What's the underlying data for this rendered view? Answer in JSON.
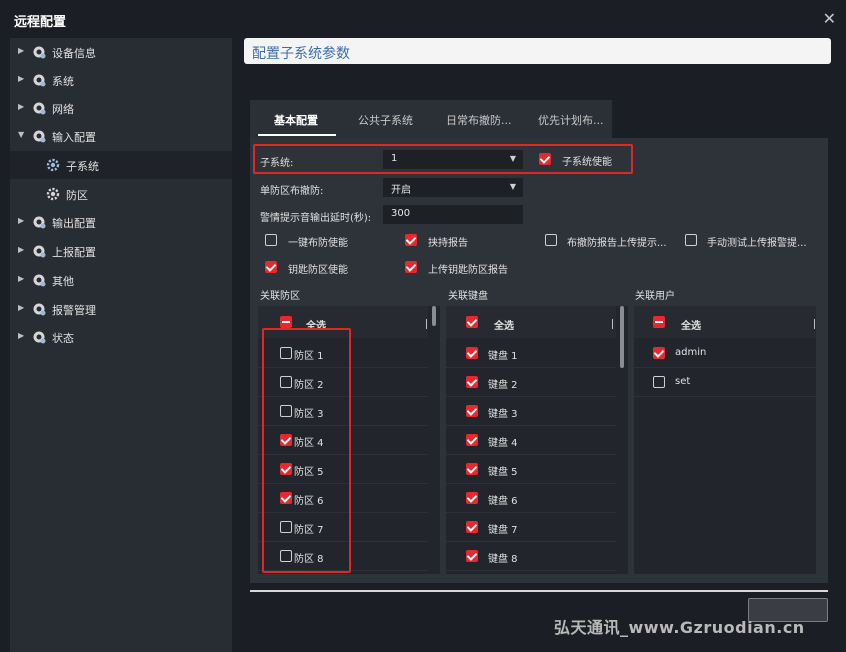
{
  "window": {
    "title": "远程配置",
    "close": "✕"
  },
  "sidebar": {
    "items": [
      {
        "label": "设备信息"
      },
      {
        "label": "系统"
      },
      {
        "label": "网络"
      },
      {
        "label": "输入配置"
      },
      {
        "label": "子系统"
      },
      {
        "label": "防区"
      },
      {
        "label": "输出配置"
      },
      {
        "label": "上报配置"
      },
      {
        "label": "其他"
      },
      {
        "label": "报警管理"
      },
      {
        "label": "状态"
      }
    ]
  },
  "header": {
    "title": "配置子系统参数"
  },
  "tabs": [
    {
      "label": "基本配置"
    },
    {
      "label": "公共子系统"
    },
    {
      "label": "日常布撤防..."
    },
    {
      "label": "优先计划布..."
    }
  ],
  "form": {
    "subsystem_label": "子系统:",
    "subsystem_value": "1",
    "subsystem_enable": "子系统使能",
    "single_zone_label": "单防区布撤防:",
    "single_zone_value": "开启",
    "alarm_delay_label": "警情提示音输出延时(秒):",
    "alarm_delay_value": "300",
    "options": {
      "one_key_arm": "一键布防使能",
      "duress_report": "挟持报告",
      "arm_report": "布撤防报告上传提示...",
      "manual_test": "手动测试上传报警提...",
      "key_zone": "钥匙防区使能",
      "upload_key_zone": "上传钥匙防区报告"
    }
  },
  "zones": {
    "title": "关联防区",
    "select_all": "全选",
    "items": [
      "防区 1",
      "防区 2",
      "防区 3",
      "防区 4",
      "防区 5",
      "防区 6",
      "防区 7",
      "防区 8"
    ]
  },
  "keyboards": {
    "title": "关联键盘",
    "select_all": "全选",
    "items": [
      "键盘 1",
      "键盘 2",
      "键盘 3",
      "键盘 4",
      "键盘 5",
      "键盘 6",
      "键盘 7",
      "键盘 8"
    ]
  },
  "users": {
    "title": "关联用户",
    "select_all": "全选",
    "items": [
      "admin",
      "set"
    ]
  },
  "watermark": "弘天通讯_www.Gzruodian.cn"
}
